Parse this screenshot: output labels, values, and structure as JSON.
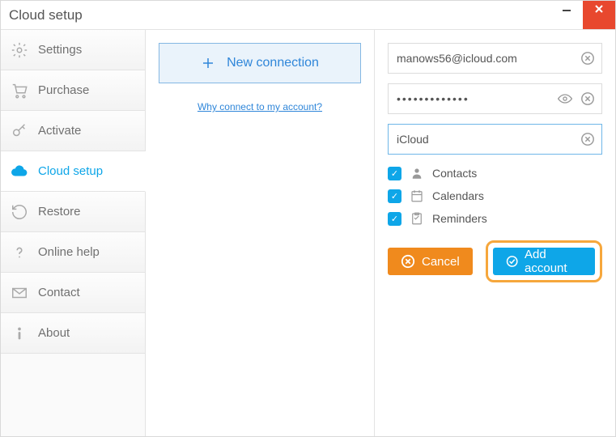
{
  "window": {
    "title": "Cloud setup"
  },
  "sidebar": {
    "items": [
      {
        "label": "Settings"
      },
      {
        "label": "Purchase"
      },
      {
        "label": "Activate"
      },
      {
        "label": "Cloud setup"
      },
      {
        "label": "Restore"
      },
      {
        "label": "Online help"
      },
      {
        "label": "Contact"
      },
      {
        "label": "About"
      }
    ]
  },
  "middle": {
    "new_connection_label": "New connection",
    "help_link_label": "Why connect to my account?"
  },
  "form": {
    "email": {
      "value": "manows56@icloud.com"
    },
    "password": {
      "value": "•••••••••••••"
    },
    "service": {
      "value": "iCloud"
    },
    "sync": {
      "contacts": {
        "label": "Contacts",
        "checked": true
      },
      "calendars": {
        "label": "Calendars",
        "checked": true
      },
      "reminders": {
        "label": "Reminders",
        "checked": true
      }
    },
    "cancel_label": "Cancel",
    "add_label": "Add account"
  }
}
